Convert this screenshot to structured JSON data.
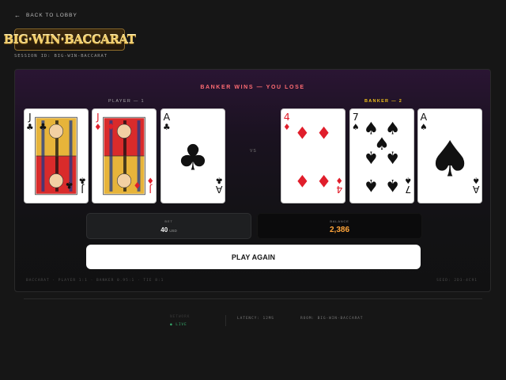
{
  "nav": {
    "back_label": "BACK TO LOBBY",
    "back_icon": "arrow-left-icon"
  },
  "brand": {
    "logo_text": "BIG·WIN·BACCARAT"
  },
  "session": {
    "label": "SESSION ID: BIG-WIN-BACCARAT"
  },
  "game": {
    "result_text": "BANKER WINS — YOU LOSE",
    "result_color": "#ff6b73",
    "vs_label": "VS",
    "player": {
      "label": "PLAYER — 1",
      "cards": [
        {
          "rank": "J",
          "suit": "clubs"
        },
        {
          "rank": "J",
          "suit": "diamonds"
        },
        {
          "rank": "A",
          "suit": "clubs"
        }
      ]
    },
    "banker": {
      "label": "BANKER — 2",
      "label_color": "#f1c21b",
      "cards": [
        {
          "rank": "4",
          "suit": "diamonds"
        },
        {
          "rank": "7",
          "suit": "spades"
        },
        {
          "rank": "A",
          "suit": "spades"
        }
      ]
    },
    "bet": {
      "label": "BET",
      "value": "40",
      "unit": "USD"
    },
    "balance": {
      "label": "BALANCE",
      "value": "2,386",
      "color": "#ffa53a"
    },
    "play_again_label": "PLAY AGAIN",
    "rules_text": "BACCARAT · PLAYER 1:1 · BANKER 0.95:1 · TIE 8:1",
    "seed_text": "SEED: 2D3-4C91"
  },
  "footer": {
    "connection_label": "NETWORK",
    "connection_status": "● LIVE",
    "latency": "LATENCY: 12MS",
    "room": "ROOM: BIG-WIN-BACCARAT"
  }
}
